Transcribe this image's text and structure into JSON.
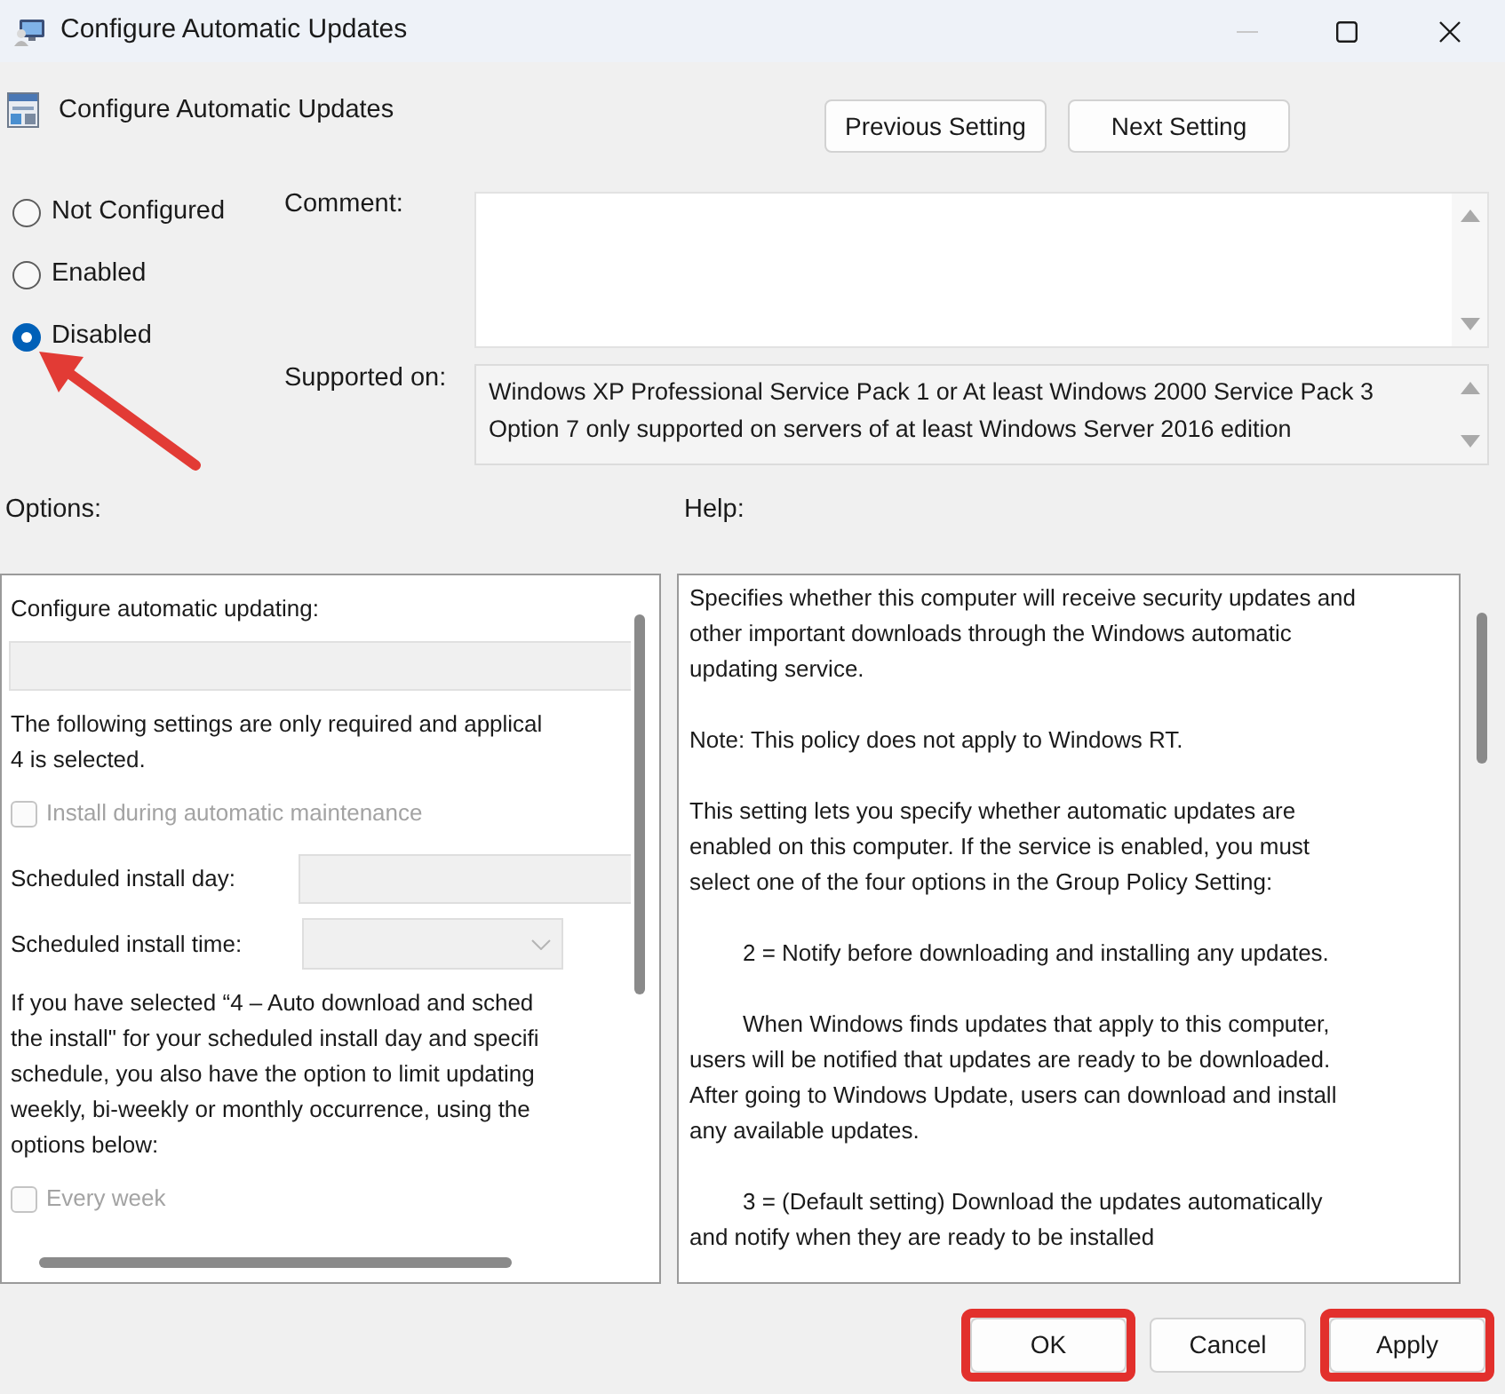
{
  "window": {
    "title": "Configure Automatic Updates"
  },
  "policy": {
    "title": "Configure Automatic Updates"
  },
  "nav_buttons": [
    {
      "label": "Previous Setting"
    },
    {
      "label": "Next Setting"
    }
  ],
  "state_options": [
    {
      "label": "Not Configured",
      "selected": false,
      "annotated": false
    },
    {
      "label": "Enabled",
      "selected": false,
      "annotated": false
    },
    {
      "label": "Disabled",
      "selected": true,
      "annotated": true
    }
  ],
  "comment": {
    "label": "Comment:"
  },
  "supported_on": {
    "label": "Supported on:",
    "text": "Windows XP Professional Service Pack 1 or At least Windows 2000 Service Pack 3\nOption 7 only supported on servers of at least Windows Server 2016 edition"
  },
  "options": {
    "label": "Options:",
    "items": [
      {
        "kind": "text",
        "text": "Configure automatic updating:"
      },
      {
        "kind": "select",
        "disabled": true
      },
      {
        "kind": "text",
        "text": "The following settings are only required and applical\n4 is selected."
      },
      {
        "kind": "checkbox",
        "label": "Install during automatic maintenance",
        "checked": false,
        "disabled": true
      },
      {
        "kind": "input",
        "label": "Scheduled install day:",
        "disabled": true
      },
      {
        "kind": "select",
        "label": "Scheduled install time:",
        "disabled": true
      },
      {
        "kind": "text",
        "text": "If you have selected “4 – Auto download and sched\nthe install\" for your scheduled install day and specifi\nschedule, you also have the option to limit updating\nweekly, bi-weekly or monthly occurrence, using the\noptions below:"
      },
      {
        "kind": "checkbox",
        "label": "Every week",
        "checked": false,
        "disabled": true
      }
    ]
  },
  "help": {
    "label": "Help:",
    "paragraphs": [
      {
        "text": "Specifies whether this computer will receive security updates and\nother important downloads through the Windows automatic\nupdating service.",
        "indent": false
      },
      {
        "text": "Note: This policy does not apply to Windows RT.",
        "indent": false
      },
      {
        "text": "This setting lets you specify whether automatic updates are\nenabled on this computer. If the service is enabled, you must\nselect one of the four options in the Group Policy Setting:",
        "indent": false
      },
      {
        "text": "2 = Notify before downloading and installing any updates.",
        "indent": true
      },
      {
        "text": "When Windows finds updates that apply to this computer,\nusers will be notified that updates are ready to be downloaded.\nAfter going to Windows Update, users can download and install\nany available updates.",
        "indent": true
      },
      {
        "text": "3 = (Default setting) Download the updates automatically\nand notify when they are ready to be installed",
        "indent": true
      }
    ]
  },
  "buttons": [
    {
      "label": "OK",
      "highlighted": true
    },
    {
      "label": "Cancel",
      "highlighted": false
    },
    {
      "label": "Apply",
      "highlighted": true
    }
  ]
}
